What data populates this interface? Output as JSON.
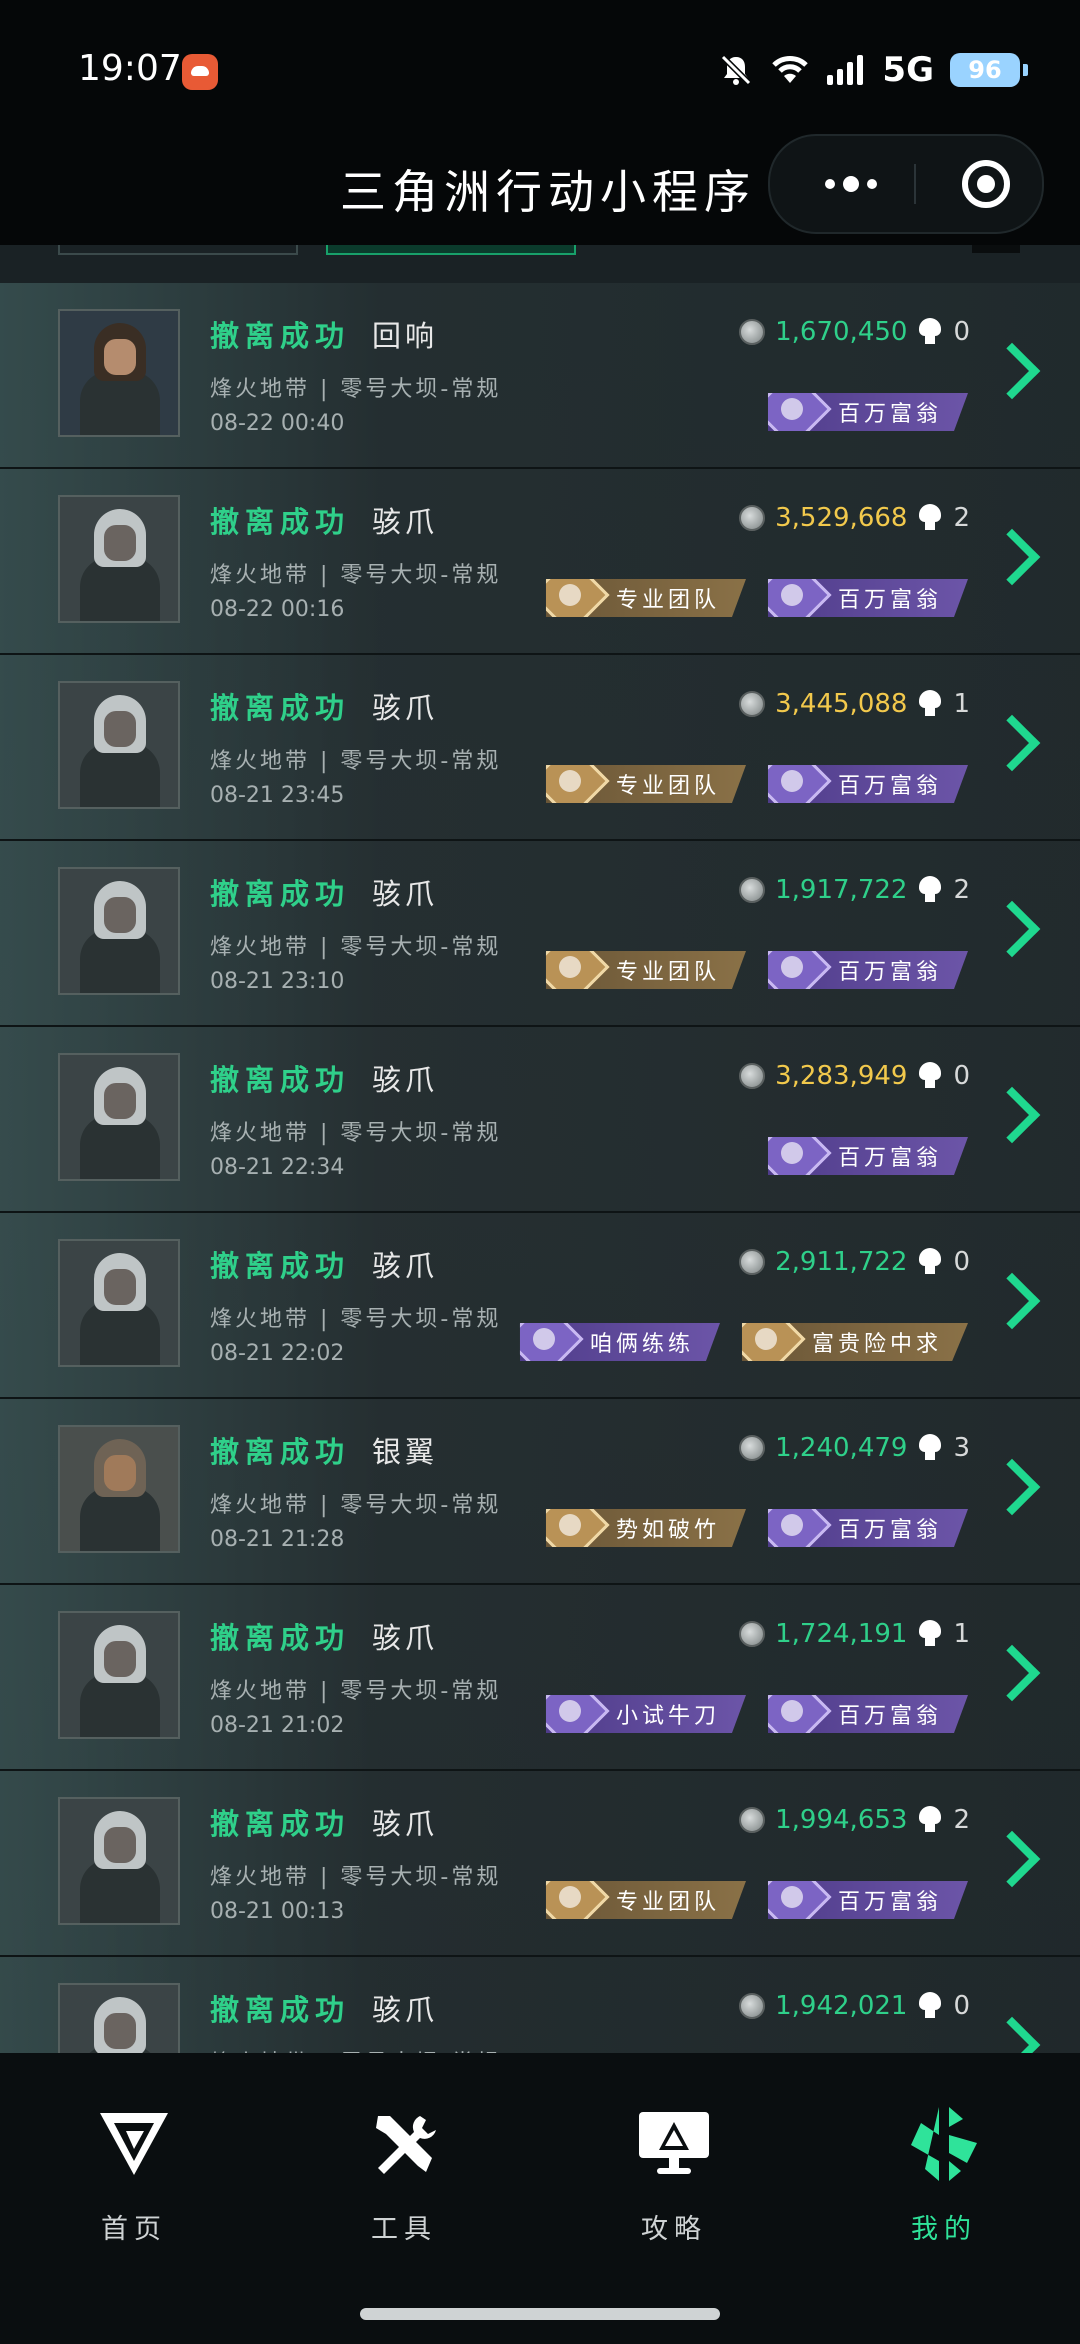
{
  "statusbar": {
    "time": "19:07",
    "network": "5G",
    "battery": "96"
  },
  "titlebar": {
    "title": "三角洲行动小程序"
  },
  "records": [
    {
      "status": "撤离成功",
      "operator": "回响",
      "map": "烽火地带 | 零号大坝-常规",
      "datetime": "08-22 00:40",
      "amount": "1,670,450",
      "amount_color": "#2fd08a",
      "kills": "0",
      "avatar": "male",
      "badges": [
        {
          "label": "百万富翁",
          "style": "purple"
        }
      ]
    },
    {
      "status": "撤离成功",
      "operator": "骇爪",
      "map": "烽火地带 | 零号大坝-常规",
      "datetime": "08-22 00:16",
      "amount": "3,529,668",
      "amount_color": "#f2c94c",
      "kills": "2",
      "avatar": "female",
      "badges": [
        {
          "label": "专业团队",
          "style": "gold"
        },
        {
          "label": "百万富翁",
          "style": "purple"
        }
      ]
    },
    {
      "status": "撤离成功",
      "operator": "骇爪",
      "map": "烽火地带 | 零号大坝-常规",
      "datetime": "08-21 23:45",
      "amount": "3,445,088",
      "amount_color": "#f2c94c",
      "kills": "1",
      "avatar": "female",
      "badges": [
        {
          "label": "专业团队",
          "style": "gold"
        },
        {
          "label": "百万富翁",
          "style": "purple"
        }
      ]
    },
    {
      "status": "撤离成功",
      "operator": "骇爪",
      "map": "烽火地带 | 零号大坝-常规",
      "datetime": "08-21 23:10",
      "amount": "1,917,722",
      "amount_color": "#2fd08a",
      "kills": "2",
      "avatar": "female",
      "badges": [
        {
          "label": "专业团队",
          "style": "gold"
        },
        {
          "label": "百万富翁",
          "style": "purple"
        }
      ]
    },
    {
      "status": "撤离成功",
      "operator": "骇爪",
      "map": "烽火地带 | 零号大坝-常规",
      "datetime": "08-21 22:34",
      "amount": "3,283,949",
      "amount_color": "#f2c94c",
      "kills": "0",
      "avatar": "female",
      "badges": [
        {
          "label": "百万富翁",
          "style": "purple"
        }
      ]
    },
    {
      "status": "撤离成功",
      "operator": "骇爪",
      "map": "烽火地带 | 零号大坝-常规",
      "datetime": "08-21 22:02",
      "amount": "2,911,722",
      "amount_color": "#2fd08a",
      "kills": "0",
      "avatar": "female",
      "badges": [
        {
          "label": "咱俩练练",
          "style": "purple"
        },
        {
          "label": "富贵险中求",
          "style": "gold"
        }
      ]
    },
    {
      "status": "撤离成功",
      "operator": "银翼",
      "map": "烽火地带 | 零号大坝-常规",
      "datetime": "08-21 21:28",
      "amount": "1,240,479",
      "amount_color": "#2fd08a",
      "kills": "3",
      "avatar": "silver",
      "badges": [
        {
          "label": "势如破竹",
          "style": "gold"
        },
        {
          "label": "百万富翁",
          "style": "purple"
        }
      ]
    },
    {
      "status": "撤离成功",
      "operator": "骇爪",
      "map": "烽火地带 | 零号大坝-常规",
      "datetime": "08-21 21:02",
      "amount": "1,724,191",
      "amount_color": "#2fd08a",
      "kills": "1",
      "avatar": "female",
      "badges": [
        {
          "label": "小试牛刀",
          "style": "purple"
        },
        {
          "label": "百万富翁",
          "style": "purple"
        }
      ]
    },
    {
      "status": "撤离成功",
      "operator": "骇爪",
      "map": "烽火地带 | 零号大坝-常规",
      "datetime": "08-21 00:13",
      "amount": "1,994,653",
      "amount_color": "#2fd08a",
      "kills": "2",
      "avatar": "female",
      "badges": [
        {
          "label": "专业团队",
          "style": "gold"
        },
        {
          "label": "百万富翁",
          "style": "purple"
        }
      ]
    },
    {
      "status": "撤离成功",
      "operator": "骇爪",
      "map": "烽火地带 | 零号大坝-常规",
      "datetime": "",
      "amount": "1,942,021",
      "amount_color": "#2fd08a",
      "kills": "0",
      "avatar": "female",
      "badges": []
    }
  ],
  "nav": [
    {
      "label": "首页",
      "icon": "home-logo-icon",
      "active": false
    },
    {
      "label": "工具",
      "icon": "tools-icon",
      "active": false
    },
    {
      "label": "攻略",
      "icon": "guide-monitor-icon",
      "active": false
    },
    {
      "label": "我的",
      "icon": "profile-logo-icon",
      "active": true
    }
  ],
  "colors": {
    "accent": "#2fe39a",
    "gold_amount": "#f2c94c",
    "green_amount": "#2fd08a"
  }
}
